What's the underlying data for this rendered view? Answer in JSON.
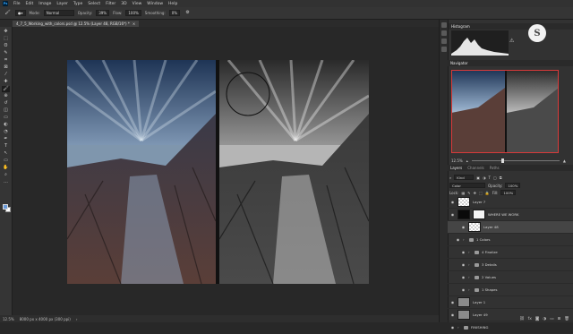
{
  "app": {
    "logo": "Ps"
  },
  "menubar": {
    "items": [
      "File",
      "Edit",
      "Image",
      "Layer",
      "Type",
      "Select",
      "Filter",
      "3D",
      "View",
      "Window",
      "Help"
    ]
  },
  "options": {
    "mode_label": "Mode:",
    "mode_value": "Normal",
    "opacity_label": "Opacity:",
    "opacity_value": "39%",
    "flow_label": "Flow:",
    "flow_value": "100%",
    "smoothing_label": "Smoothing:",
    "smoothing_value": "0%"
  },
  "document": {
    "tab_title": "4_7_5_Working_with_colors.psd @ 12.5% (Layer 48, RGB/16*) *",
    "close_glyph": "×"
  },
  "status": {
    "zoom": "12.5%",
    "doc_info": "8000 px x 4000 px (300 ppi)"
  },
  "panels": {
    "histogram_title": "Histogram",
    "navigator_title": "Navigator",
    "navigator_zoom": "12.5%",
    "layers_tabs": [
      "Layers",
      "Channels",
      "Paths"
    ],
    "kind_label": "Kind",
    "blend_mode": "Color",
    "opacity_label": "Opacity:",
    "opacity_value": "100%",
    "lock_label": "Lock:",
    "fill_label": "Fill:",
    "fill_value": "100%"
  },
  "layers": [
    {
      "name": "Layer 7",
      "thumb": "checker",
      "indent": 0,
      "type": "layer"
    },
    {
      "name": "WHERE WE WORK",
      "thumb": "black",
      "indent": 0,
      "type": "mask"
    },
    {
      "name": "Layer 48",
      "thumb": "checker",
      "indent": 2,
      "type": "layer",
      "selected": true
    },
    {
      "name": "1 Colors",
      "thumb": "",
      "indent": 1,
      "type": "group"
    },
    {
      "name": "4 Finalize",
      "thumb": "",
      "indent": 2,
      "type": "group"
    },
    {
      "name": "3 Details",
      "thumb": "",
      "indent": 2,
      "type": "group"
    },
    {
      "name": "2 Values",
      "thumb": "",
      "indent": 2,
      "type": "group"
    },
    {
      "name": "1 Shapes",
      "thumb": "",
      "indent": 2,
      "type": "group"
    },
    {
      "name": "Layer 1",
      "thumb": "gray",
      "indent": 0,
      "type": "layer"
    },
    {
      "name": "Layer 49",
      "thumb": "gray",
      "indent": 0,
      "type": "layer"
    },
    {
      "name": "FINISHING",
      "thumb": "",
      "indent": 0,
      "type": "group"
    }
  ],
  "tools": [
    "move-icon",
    "marquee-icon",
    "lasso-icon",
    "quick-select-icon",
    "crop-icon",
    "frame-icon",
    "eyedropper-icon",
    "healing-icon",
    "brush-icon",
    "clone-stamp-icon",
    "history-brush-icon",
    "eraser-icon",
    "gradient-icon",
    "blur-icon",
    "dodge-icon",
    "pen-icon",
    "type-icon",
    "path-select-icon",
    "rectangle-icon",
    "hand-icon",
    "zoom-icon",
    "more-icon"
  ],
  "tool_glyphs": [
    "✥",
    "⬚",
    "ʘ",
    "✎",
    "⌗",
    "⊠",
    "⁄",
    "✚",
    "🖌",
    "⊕",
    "↺",
    "◫",
    "▭",
    "◐",
    "◔",
    "✒",
    "T",
    "↖",
    "▭",
    "✋",
    "⌕",
    "…"
  ],
  "colors": {
    "foreground": "#6a9ad8",
    "background": "#ffffff",
    "nav_highlight": "#d93a3a"
  },
  "watermark": "S"
}
